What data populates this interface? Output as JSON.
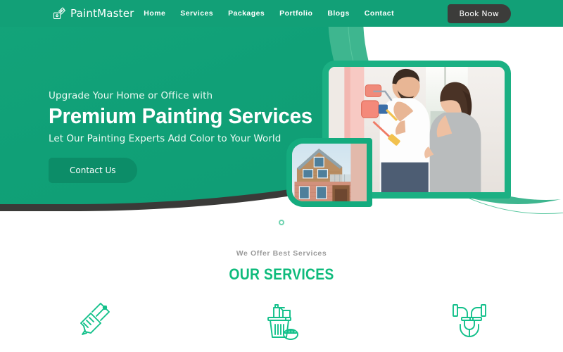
{
  "header": {
    "brand_name": "PaintMaster",
    "brand_icon": "paint-bucket-brush-icon",
    "nav": [
      {
        "label": "Home"
      },
      {
        "label": "Services"
      },
      {
        "label": "Packages"
      },
      {
        "label": "Portfolio"
      },
      {
        "label": "Blogs"
      },
      {
        "label": "Contact"
      }
    ],
    "book_button": "Book Now"
  },
  "hero": {
    "eyebrow": "Upgrade Your Home or Office with",
    "title": "Premium Painting Services",
    "subtitle": "Let Our Painting Experts Add Color to Your World",
    "cta": "Contact Us",
    "main_photo_alt": "couple painting wall with paint rollers",
    "small_photo_alt": "modern wooden house exterior"
  },
  "services": {
    "eyebrow": "We Offer Best Services",
    "title": "OUR SERVICES",
    "items": [
      {
        "icon": "paint-brush-icon",
        "name": "painting"
      },
      {
        "icon": "cleaning-supplies-icon",
        "name": "cleaning"
      },
      {
        "icon": "plumbing-pipes-icon",
        "name": "plumbing"
      }
    ]
  },
  "colors": {
    "brand_green": "#12a077",
    "light_green": "#3eb68f",
    "accent_green": "#0fbb7c",
    "dark_charcoal": "#3c3c3a",
    "button_green": "#0c8d68"
  }
}
